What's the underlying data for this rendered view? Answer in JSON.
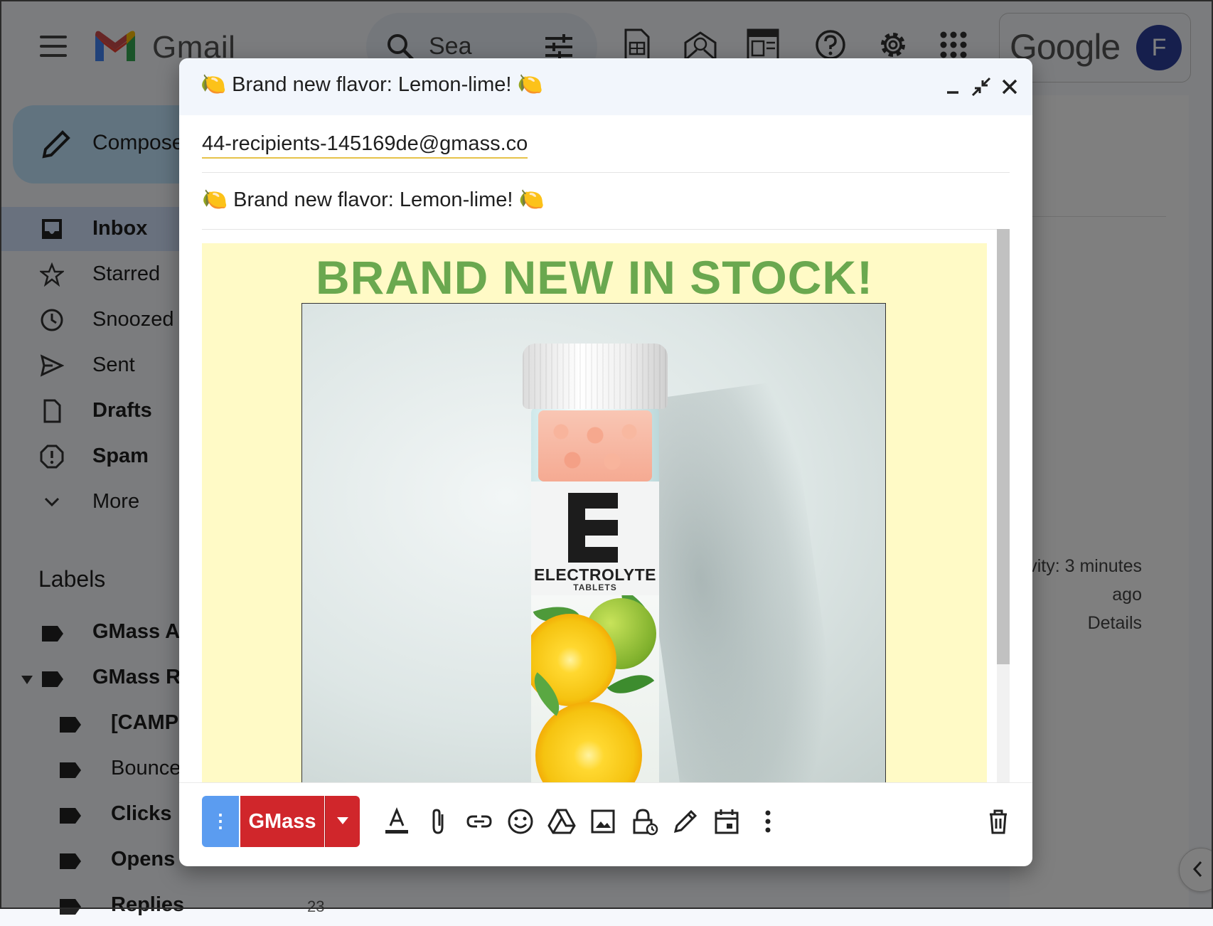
{
  "gmail": {
    "app_name": "Gmail",
    "search_placeholder": "Sea",
    "google_word": "Google",
    "avatar_initial": "F",
    "compose_label": "Compose",
    "nav": [
      {
        "label": "Inbox"
      },
      {
        "label": "Starred"
      },
      {
        "label": "Snoozed"
      },
      {
        "label": "Sent"
      },
      {
        "label": "Drafts"
      },
      {
        "label": "Spam"
      },
      {
        "label": "More"
      }
    ],
    "labels_title": "Labels",
    "labels": [
      {
        "label": "GMass A"
      },
      {
        "label": "GMass R"
      },
      {
        "label": "[CAMP"
      },
      {
        "label": "Bounce"
      },
      {
        "label": "Clicks"
      },
      {
        "label": "Opens"
      },
      {
        "label": "Replies"
      }
    ],
    "replies_count": "23",
    "activity_line1": "vity: 3 minutes",
    "activity_line2": "ago",
    "details_link": "Details"
  },
  "compose": {
    "title": "🍋 Brand new flavor: Lemon-lime! 🍋",
    "to": "44-recipients-145169de@gmass.co",
    "subject": "🍋 Brand new flavor: Lemon-lime! 🍋",
    "body_heading": "BRAND NEW IN STOCK!",
    "product_label_letter": "E",
    "product_label_name": "ELECTROLYTE",
    "product_label_sub": "TABLETS",
    "gmass_button": "GMass",
    "more_dots": "⋮"
  },
  "colors": {
    "email_bg": "#fffac6",
    "heading_green": "#6aa84f",
    "gmass_red": "#d0262b",
    "dots_blue": "#5b9cf0"
  }
}
